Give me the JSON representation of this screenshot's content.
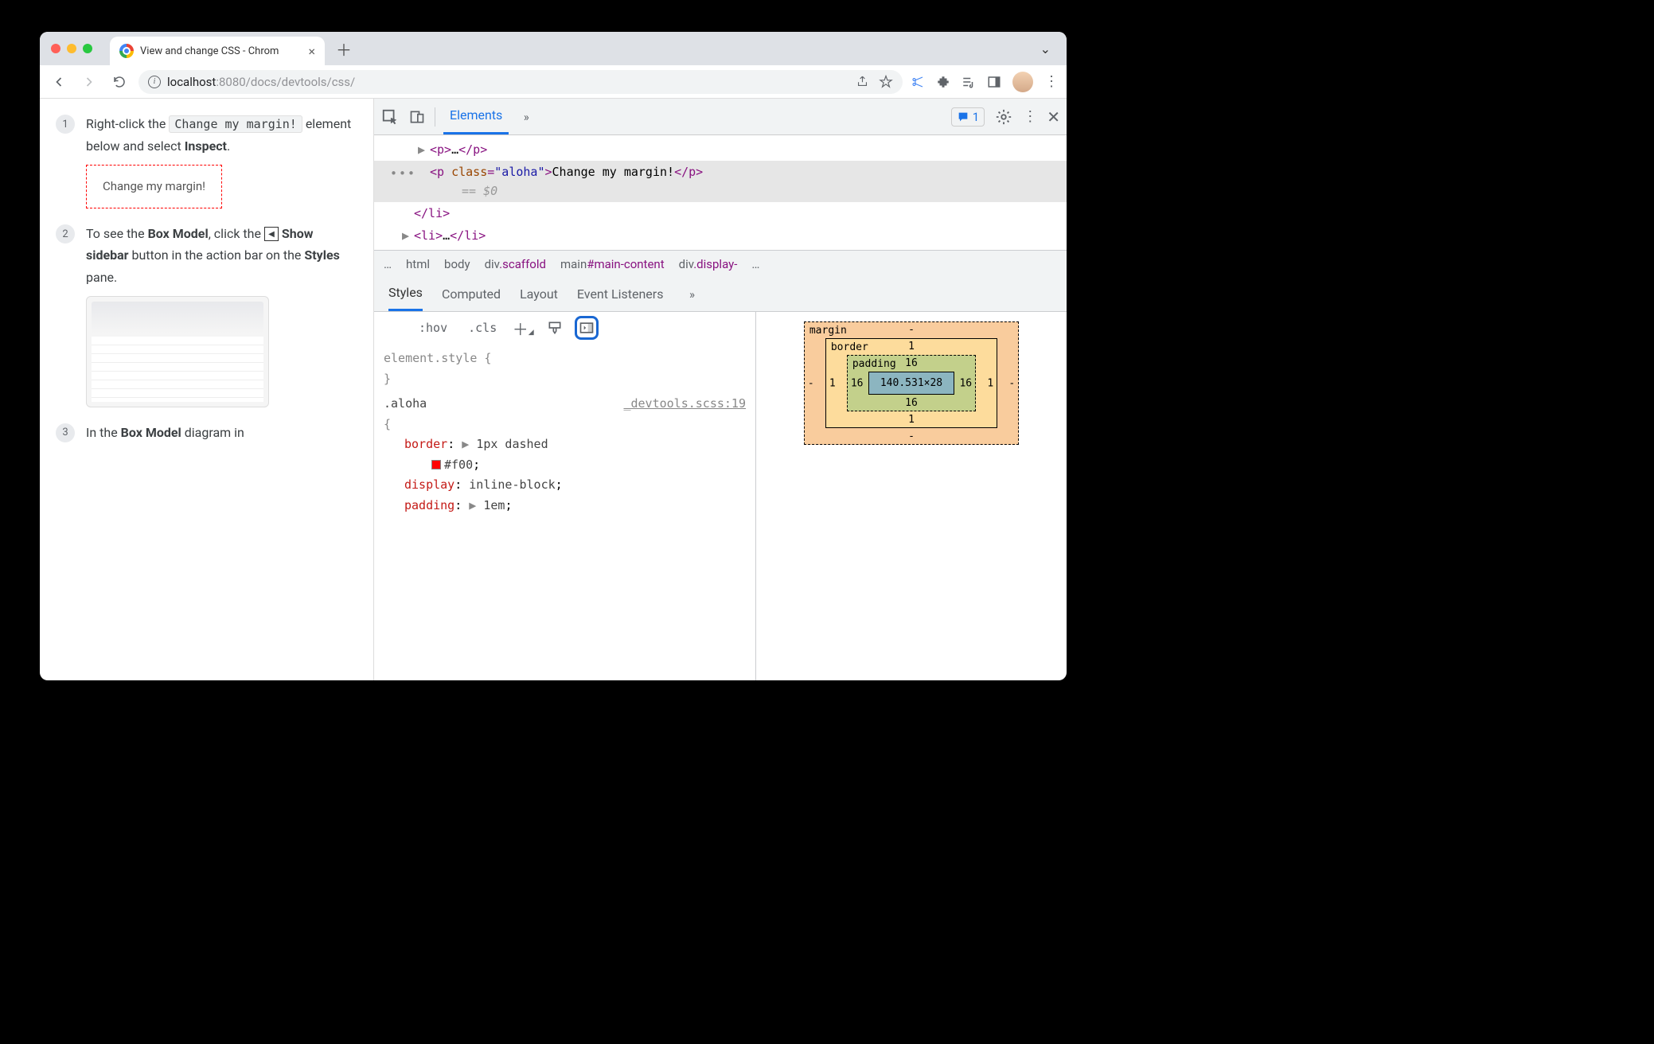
{
  "browser": {
    "tab_title": "View and change CSS - Chrom",
    "url_host": "localhost",
    "url_port_path": ":8080/docs/devtools/css/"
  },
  "page": {
    "steps": [
      {
        "num": "1",
        "pre": "Right-click the ",
        "code": "Change my margin!",
        "post": " element below and select ",
        "bold": "Inspect",
        "tail": ".",
        "callout": "Change my margin!"
      },
      {
        "num": "2",
        "pre": "To see the ",
        "bold1": "Box Model",
        "mid": ", click the ",
        "icon": "◀",
        "bold2": "Show sidebar",
        "post": " button in the action bar on the ",
        "bold3": "Styles",
        "tail": " pane."
      },
      {
        "num": "3",
        "pre": "In the ",
        "bold1": "Box Model",
        "post": " diagram in "
      }
    ]
  },
  "devtools": {
    "main_tab": "Elements",
    "issues_count": "1",
    "dom": {
      "line1": "<p>…</p>",
      "sel_open": "<p class=\"aloha\">",
      "sel_attr_name": "class",
      "sel_attr_val": "\"aloha\"",
      "sel_text": "Change my margin!",
      "sel_close": "</p>",
      "sel_suffix": "== $0",
      "line3": "</li>",
      "line4": "<li>…</li>"
    },
    "crumbs": [
      "…",
      "html",
      "body",
      "div.scaffold",
      "main#main-content",
      "div.display-",
      "…"
    ],
    "tabs2": [
      "Styles",
      "Computed",
      "Layout",
      "Event Listeners"
    ],
    "toolbar": {
      "hov": ":hov",
      "cls": ".cls"
    },
    "styles": {
      "element_style": "element.style {",
      "close": "}",
      "selector": ".aloha",
      "source": "_devtools.scss:19",
      "open": "{",
      "rules": [
        {
          "prop": "border",
          "val": "1px dashed",
          "color": "#f00"
        },
        {
          "prop": "display",
          "val": "inline-block"
        },
        {
          "prop": "padding",
          "val": "1em"
        }
      ]
    },
    "boxmodel": {
      "margin": {
        "label": "margin",
        "t": "-",
        "r": "-",
        "b": "-",
        "l": "-"
      },
      "border": {
        "label": "border",
        "t": "1",
        "r": "1",
        "b": "1",
        "l": "1"
      },
      "padding": {
        "label": "padding",
        "t": "16",
        "r": "16",
        "b": "16",
        "l": "16"
      },
      "content": "140.531×28"
    }
  }
}
